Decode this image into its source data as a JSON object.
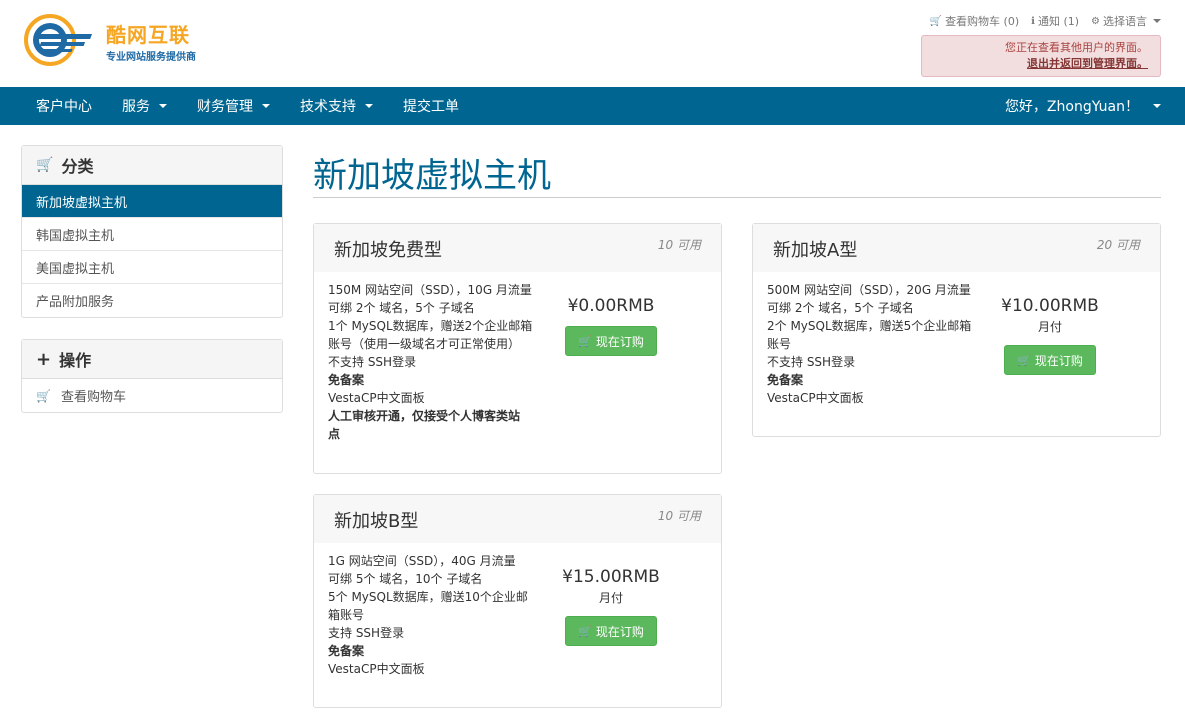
{
  "header": {
    "logo_title": "酷网互联",
    "logo_subtitle": "专业网站服务提供商",
    "cart_link": "查看购物车 (0)",
    "notifications_link": "通知 (1)",
    "language_link": "选择语言"
  },
  "alert": {
    "message": "您正在查看其他用户的界面。",
    "exit_link": "退出并返回到管理界面。"
  },
  "nav": {
    "items": [
      {
        "label": "客户中心"
      },
      {
        "label": "服务"
      },
      {
        "label": "财务管理"
      },
      {
        "label": "技术支持"
      },
      {
        "label": "提交工单"
      }
    ],
    "user": "您好，ZhongYuan！"
  },
  "sidebar": {
    "categories_title": "分类",
    "categories": [
      {
        "label": "新加坡虚拟主机"
      },
      {
        "label": "韩国虚拟主机"
      },
      {
        "label": "美国虚拟主机"
      },
      {
        "label": "产品附加服务"
      }
    ],
    "actions_title": "操作",
    "actions": [
      {
        "label": "查看购物车"
      }
    ]
  },
  "page": {
    "title": "新加坡虚拟主机"
  },
  "products": [
    {
      "name": "新加坡免费型",
      "qty": "10 可用",
      "features": [
        "150M 网站空间（SSD），10G 月流量",
        "可绑 2个 域名，5个 子域名",
        "1个 MySQL数据库，赠送2个企业邮箱",
        "账号（使用一级域名才可正常使用）",
        "不支持 SSH登录",
        "免备案",
        "VestaCP中文面板",
        "人工审核开通，仅接受个人博客类站",
        "点"
      ],
      "price": "¥0.00RMB",
      "cycle": "",
      "button": "现在订购"
    },
    {
      "name": "新加坡A型",
      "qty": "20 可用",
      "features": [
        "500M 网站空间（SSD），20G 月流量",
        "可绑 2个 域名，5个 子域名",
        "2个 MySQL数据库，赠送5个企业邮箱",
        "账号",
        "不支持 SSH登录",
        "免备案",
        "VestaCP中文面板"
      ],
      "price": "¥10.00RMB",
      "cycle": "月付",
      "button": "现在订购"
    },
    {
      "name": "新加坡B型",
      "qty": "10 可用",
      "features": [
        "1G 网站空间（SSD），40G 月流量",
        "可绑 5个 域名，10个 子域名",
        "5个 MySQL数据库，赠送10个企业邮",
        "箱账号",
        "支持 SSH登录",
        "免备案",
        "VestaCP中文面板"
      ],
      "price": "¥15.00RMB",
      "cycle": "月付",
      "button": "现在订购"
    }
  ],
  "colors": {
    "brand_blue": "#006590",
    "logo_orange": "#f5a623",
    "button_green": "#5cb85c",
    "alert_bg": "#f2dede"
  }
}
